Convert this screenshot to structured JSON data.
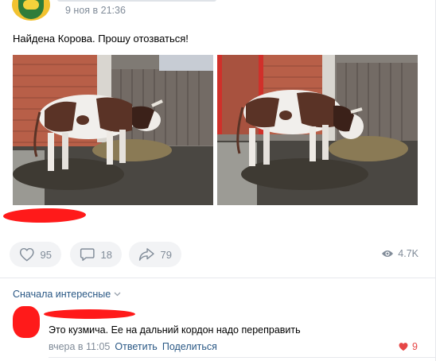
{
  "post": {
    "date": "9 ноя в 21:36",
    "text": "Найдена Корова. Прошу отозваться!",
    "likes": "95",
    "comments": "18",
    "shares": "79",
    "views": "4.7K"
  },
  "comments_section": {
    "sort_label": "Сначала интересные",
    "items": [
      {
        "text": "Это кузмича. Ее на дальний кордон надо переправить",
        "date": "вчера в 11:05",
        "reply_label": "Ответить",
        "share_label": "Поделиться",
        "likes": "9"
      }
    ]
  },
  "colors": {
    "link": "#2a5885",
    "muted": "#818c99",
    "button_bg": "#f2f3f5",
    "like_red": "#e64646",
    "redaction": "#ff1a1a"
  }
}
